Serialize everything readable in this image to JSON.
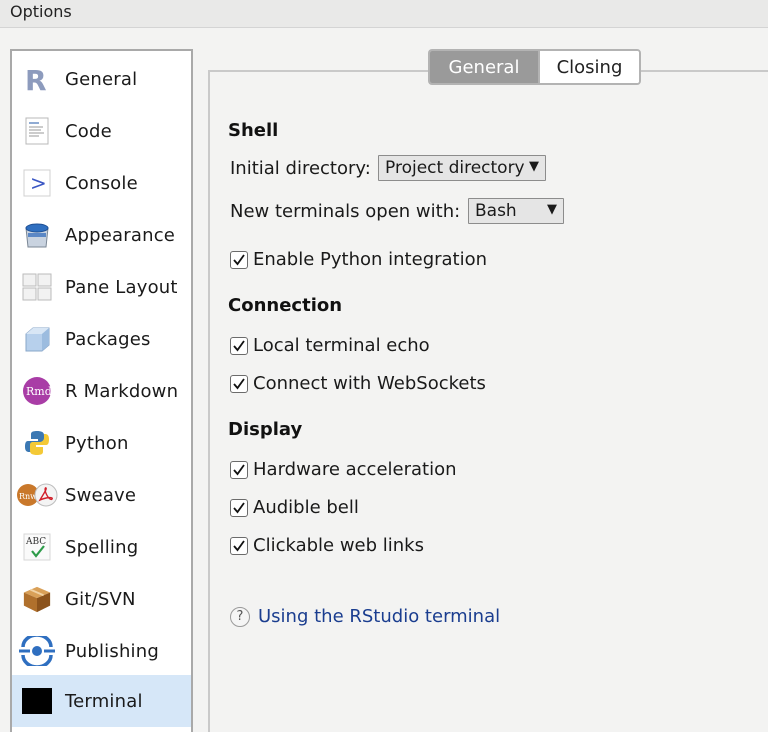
{
  "window": {
    "title": "Options"
  },
  "sidebar": {
    "items": [
      {
        "label": "General",
        "icon": "r-logo-icon"
      },
      {
        "label": "Code",
        "icon": "code-document-icon"
      },
      {
        "label": "Console",
        "icon": "console-prompt-icon"
      },
      {
        "label": "Appearance",
        "icon": "paint-bucket-icon"
      },
      {
        "label": "Pane Layout",
        "icon": "pane-layout-icon"
      },
      {
        "label": "Packages",
        "icon": "package-cube-icon"
      },
      {
        "label": "R Markdown",
        "icon": "rmd-icon"
      },
      {
        "label": "Python",
        "icon": "python-icon"
      },
      {
        "label": "Sweave",
        "icon": "sweave-pdf-icon"
      },
      {
        "label": "Spelling",
        "icon": "spelling-abc-icon"
      },
      {
        "label": "Git/SVN",
        "icon": "git-box-icon"
      },
      {
        "label": "Publishing",
        "icon": "publishing-icon"
      },
      {
        "label": "Terminal",
        "icon": "terminal-icon"
      }
    ],
    "selected": "Terminal"
  },
  "tabs": {
    "general": "General",
    "closing": "Closing",
    "active": "General"
  },
  "shell": {
    "title": "Shell",
    "initial_directory_label": "Initial directory:",
    "initial_directory_value": "Project directory",
    "new_terminals_label": "New terminals open with:",
    "new_terminals_value": "Bash",
    "python_integration_label": "Enable Python integration",
    "python_integration_checked": true
  },
  "connection": {
    "title": "Connection",
    "local_echo_label": "Local terminal echo",
    "local_echo_checked": true,
    "websockets_label": "Connect with WebSockets",
    "websockets_checked": true
  },
  "display": {
    "title": "Display",
    "hw_accel_label": "Hardware acceleration",
    "hw_accel_checked": true,
    "audible_bell_label": "Audible bell",
    "audible_bell_checked": true,
    "web_links_label": "Clickable web links",
    "web_links_checked": true
  },
  "help": {
    "link_text": "Using the RStudio terminal",
    "icon_glyph": "?"
  },
  "colors": {
    "selected_bg": "#d6e7f8",
    "tab_active_bg": "#9a9a9a",
    "link": "#1a3d8f"
  }
}
